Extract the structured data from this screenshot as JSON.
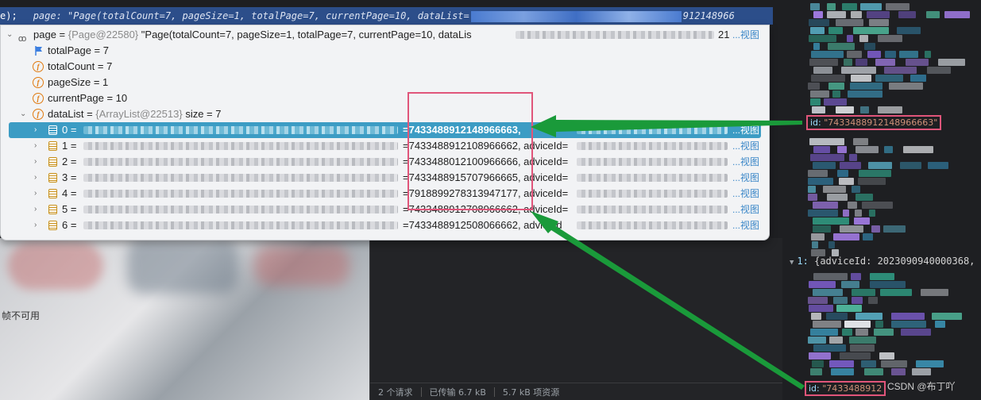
{
  "eval_bar": {
    "code": "e);",
    "expression": "page: \"Page(totalCount=7, pageSize=1, totalPage=7, currentPage=10, dataList=",
    "tail": "912148966"
  },
  "popup": {
    "root": {
      "name": "page",
      "ref": "{Page@22580}",
      "value": "\"Page(totalCount=7, pageSize=1, totalPage=7, currentPage=10, dataLis",
      "suffix": "21",
      "view": "...视图"
    },
    "fields": [
      {
        "name": "totalPage",
        "value": "7",
        "icon": "flag-icon"
      },
      {
        "name": "totalCount",
        "value": "7",
        "icon": "field-icon"
      },
      {
        "name": "pageSize",
        "value": "1",
        "icon": "field-icon"
      },
      {
        "name": "currentPage",
        "value": "10",
        "icon": "field-icon"
      }
    ],
    "datalist": {
      "name": "dataList",
      "ref": "{ArrayList@22513}",
      "size": "size = 7"
    },
    "items": [
      {
        "index": "0 =",
        "value": "=7433488912148966663,",
        "view": "...视图",
        "selected": true
      },
      {
        "index": "1 =",
        "value": "=7433488912108966662, adviceId=",
        "view": "...视图",
        "selected": false
      },
      {
        "index": "2 =",
        "value": "=7433488012100966666, adviceId=",
        "view": "...视图",
        "selected": false
      },
      {
        "index": "3 =",
        "value": "=7433488915707966665, adviceId=",
        "view": "...视图",
        "selected": false
      },
      {
        "index": "4 =",
        "value": "=7918899278313947177, adviceId=",
        "view": "...视图",
        "selected": false
      },
      {
        "index": "5 =",
        "value": "=7433488912708966662, adviceId=",
        "view": "...视图",
        "selected": false
      },
      {
        "index": "6 =",
        "value": "=7433488912508066662, adviceId",
        "view": "...视图",
        "selected": false
      }
    ]
  },
  "right_panel": {
    "id_top": {
      "key": "id:",
      "value": "\"7433488912148966663\""
    },
    "tree_line": {
      "index": "1:",
      "text": "{adviceId: 2023090940000368,"
    },
    "id_bottom": {
      "key": "id:",
      "value": "\"7433488912"
    }
  },
  "left_bg": {
    "label": "帧不可用"
  },
  "status_bar": {
    "requests": "2 个请求",
    "transferred": "已传输 6.7 kB",
    "resources": "5.7 kB 项资源"
  },
  "watermark": "CSDN @布丁吖",
  "colors": {
    "selection": "#3c9cc4",
    "highlight_box": "#e0557a",
    "arrow": "#1a9a3a",
    "eval_bar": "#2c4e8a"
  }
}
